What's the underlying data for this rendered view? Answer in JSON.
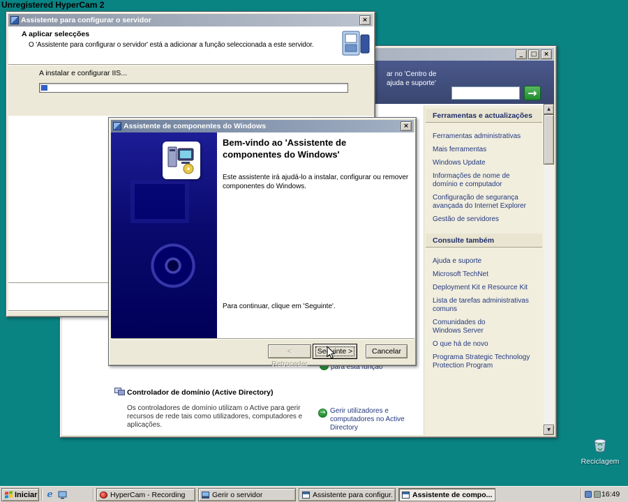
{
  "desktop": {
    "watermark": "Unregistered HyperCam 2",
    "recycle_bin": "Reciclagem"
  },
  "progress_window": {
    "title": "Assistente para configurar o servidor",
    "heading": "A aplicar selecções",
    "description": "O 'Assistente para configurar o servidor' está a adicionar a função seleccionada a este servidor.",
    "status": "A instalar e configurar IIS...",
    "progress_percent": 2
  },
  "manage_window": {
    "title": "Gerir o servidor",
    "search_caption": "ar no 'Centro de ajuda e suporte'",
    "tools_header": "Ferramentas e actualizações",
    "tools_links": [
      "Ferramentas administrativas",
      "Mais ferramentas",
      "Windows Update",
      "Informações de nome de domínio e computador",
      "Configuração de segurança avançada do Internet Explorer",
      "Gestão de servidores"
    ],
    "see_also_header": "Consulte também",
    "see_also_links": [
      "Ajuda e suporte",
      "Microsoft TechNet",
      "Deployment Kit e Resource Kit",
      "Lista de tarefas administrativas comuns",
      "Comunidades do Windows Server",
      "O que há de novo",
      "Programa Strategic Technology Protection Program"
    ],
    "partial_link": "para esta função",
    "dc_title": "Controlador de domínio (Active Directory)",
    "dc_description": "Os controladores de domínio utilizam o Active para gerir recursos de rede tais como utilizadores, computadores e aplicações.",
    "dc_link": "Gerir utilizadores e computadores no Active Directory"
  },
  "components_wizard": {
    "title": "Assistente de componentes do Windows",
    "welcome": "Bem-vindo ao 'Assistente de componentes do Windows'",
    "body": "Este assistente irá ajudá-lo a instalar, configurar ou remover componentes do Windows.",
    "hint": "Para continuar, clique em 'Seguinte'.",
    "back": "< Retroceder",
    "next": "Seguinte >",
    "cancel": "Cancelar"
  },
  "taskbar": {
    "start": "Iniciar",
    "tasks": [
      "HyperCam - Recording",
      "Gerir o servidor",
      "Assistente para configur...",
      "Assistente de compo..."
    ],
    "clock": "16:49"
  },
  "icons": {
    "close": "×",
    "minimize": "_",
    "restore": "□",
    "up_arrow": "▲",
    "down_arrow": "▼",
    "go_arrow": "→",
    "link_arrow": "→",
    "ie": "e"
  }
}
